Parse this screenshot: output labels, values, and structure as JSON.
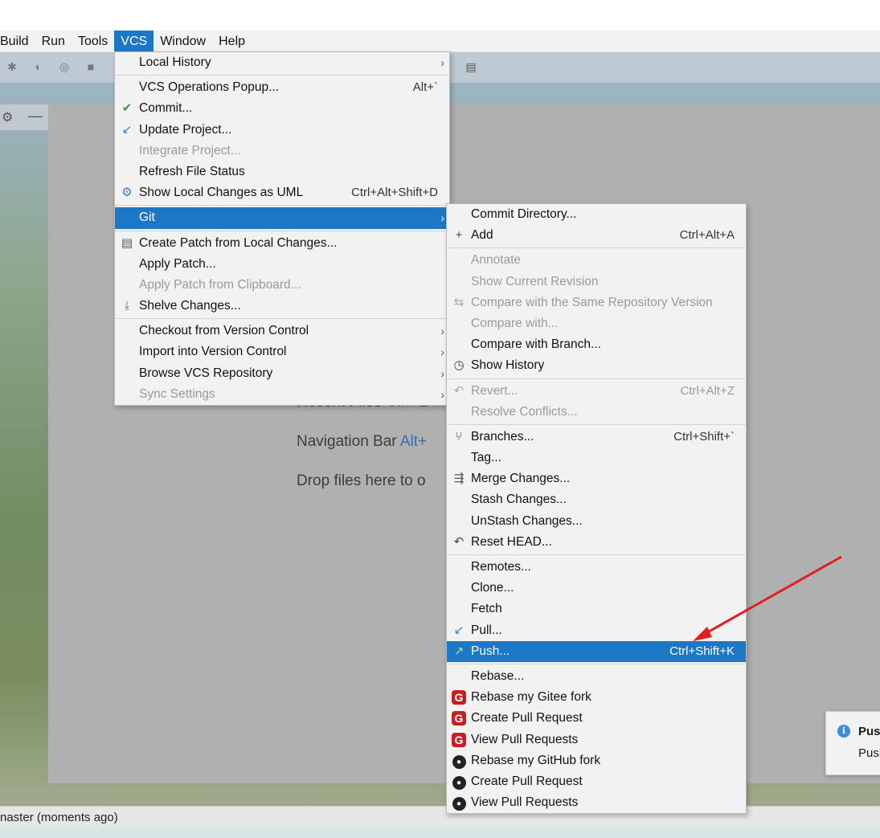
{
  "menubar": {
    "items": [
      "Build",
      "Run",
      "Tools",
      "VCS",
      "Window",
      "Help"
    ],
    "active": "VCS"
  },
  "editor": {
    "hints": [
      {
        "text": "Recent Files ",
        "shortcut": "Ctrl+E"
      },
      {
        "text": "Navigation Bar ",
        "shortcut": "Alt+"
      },
      {
        "text": "Drop files here to o",
        "shortcut": ""
      }
    ]
  },
  "statusbar": {
    "text": "naster (moments ago)"
  },
  "notification": {
    "title": "Pus",
    "body": "Pusl"
  },
  "vcs_menu": {
    "items": [
      {
        "label": "Local History",
        "submenu": true
      },
      {
        "sep": true
      },
      {
        "label": "VCS Operations Popup...",
        "shortcut": "Alt+`"
      },
      {
        "label": "Commit...",
        "icon": "check-icon"
      },
      {
        "label": "Update Project...",
        "icon": "update-arrow-icon"
      },
      {
        "label": "Integrate Project...",
        "disabled": true
      },
      {
        "label": "Refresh File Status"
      },
      {
        "label": "Show Local Changes as UML",
        "shortcut": "Ctrl+Alt+Shift+D",
        "icon": "uml-icon"
      },
      {
        "sep": true
      },
      {
        "label": "Git",
        "submenu": true,
        "selected": true
      },
      {
        "sep": true
      },
      {
        "label": "Create Patch from Local Changes...",
        "icon": "patch-icon"
      },
      {
        "label": "Apply Patch..."
      },
      {
        "label": "Apply Patch from Clipboard...",
        "disabled": true
      },
      {
        "label": "Shelve Changes...",
        "icon": "shelve-icon"
      },
      {
        "sep": true
      },
      {
        "label": "Checkout from Version Control",
        "submenu": true
      },
      {
        "label": "Import into Version Control",
        "submenu": true
      },
      {
        "label": "Browse VCS Repository",
        "submenu": true
      },
      {
        "label": "Sync Settings",
        "disabled": true,
        "submenu": true
      }
    ]
  },
  "git_menu": {
    "items": [
      {
        "label": "Commit Directory..."
      },
      {
        "label": "Add",
        "shortcut": "Ctrl+Alt+A",
        "icon": "plus-icon"
      },
      {
        "sep": true
      },
      {
        "label": "Annotate",
        "disabled": true
      },
      {
        "label": "Show Current Revision",
        "disabled": true
      },
      {
        "label": "Compare with the Same Repository Version",
        "disabled": true,
        "icon": "compare-icon"
      },
      {
        "label": "Compare with...",
        "disabled": true
      },
      {
        "label": "Compare with Branch..."
      },
      {
        "label": "Show History",
        "icon": "clock-icon"
      },
      {
        "sep": true
      },
      {
        "label": "Revert...",
        "shortcut": "Ctrl+Alt+Z",
        "disabled": true,
        "icon": "revert-icon"
      },
      {
        "label": "Resolve Conflicts...",
        "disabled": true
      },
      {
        "sep": true
      },
      {
        "label": "Branches...",
        "shortcut": "Ctrl+Shift+`",
        "icon": "branch-icon"
      },
      {
        "label": "Tag..."
      },
      {
        "label": "Merge Changes...",
        "icon": "merge-icon"
      },
      {
        "label": "Stash Changes..."
      },
      {
        "label": "UnStash Changes..."
      },
      {
        "label": "Reset HEAD...",
        "icon": "reset-icon"
      },
      {
        "sep": true
      },
      {
        "label": "Remotes..."
      },
      {
        "label": "Clone..."
      },
      {
        "label": "Fetch"
      },
      {
        "label": "Pull...",
        "icon": "pull-icon"
      },
      {
        "label": "Push...",
        "shortcut": "Ctrl+Shift+K",
        "selected": true,
        "icon": "push-icon"
      },
      {
        "sep": true
      },
      {
        "label": "Rebase..."
      },
      {
        "label": "Rebase my Gitee fork",
        "icon": "gitee-icon"
      },
      {
        "label": "Create Pull Request",
        "icon": "gitee-icon"
      },
      {
        "label": "View Pull Requests",
        "icon": "gitee-icon"
      },
      {
        "label": "Rebase my GitHub fork",
        "icon": "github-icon"
      },
      {
        "label": "Create Pull Request",
        "icon": "github-icon"
      },
      {
        "label": "View Pull Requests",
        "icon": "github-icon"
      }
    ]
  },
  "colors": {
    "selection": "#1c78c7",
    "annotation_arrow": "#e02020"
  }
}
